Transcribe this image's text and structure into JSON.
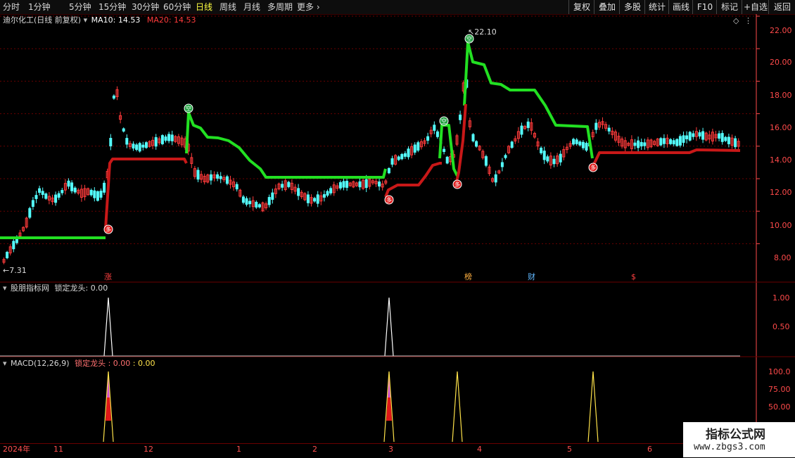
{
  "toolbar": {
    "periods": [
      "分时",
      "1分钟",
      "5分钟",
      "15分钟",
      "30分钟",
      "60分钟",
      "日线",
      "周线",
      "月线",
      "多周期",
      "更多"
    ],
    "active_period": "日线",
    "right_buttons": [
      "复权",
      "叠加",
      "多股",
      "统计",
      "画线",
      "F10",
      "标记",
      "+自选",
      "返回"
    ]
  },
  "main_panel": {
    "stock_name": "迪尔化工(日线 前复权)",
    "ma10_label": "MA10: 14.53",
    "ma20_label": "MA20: 14.53",
    "high_marker": "22.10",
    "low_marker": "7.31",
    "y_ticks": [
      "22.00",
      "20.00",
      "18.00",
      "16.00",
      "14.00",
      "12.00",
      "10.00",
      "8.00"
    ],
    "event_tags": [
      {
        "text": "涨",
        "color": "#ff4040"
      },
      {
        "text": "榜",
        "color": "#ffb040"
      },
      {
        "text": "财",
        "color": "#60b8ff"
      },
      {
        "text": "$",
        "color": "#ff4040"
      }
    ],
    "buy_label": "多",
    "sell_label": "空"
  },
  "panel2": {
    "title": "股朋指标网",
    "indicator": "锁定龙头: 0.00",
    "y_ticks": [
      "1.00",
      "0.50"
    ]
  },
  "panel3": {
    "title": "MACD(12,26,9)",
    "indicator": "锁定龙头 : 0.00",
    "value2": ": 0.00",
    "y_ticks": [
      "100.0",
      "75.00",
      "50.00"
    ]
  },
  "time_axis": {
    "labels": [
      "2024年",
      "11",
      "12",
      "1",
      "2",
      "3",
      "4",
      "5",
      "6"
    ]
  },
  "watermark": {
    "title": "指标公式网",
    "url": "www.zbgs3.com"
  },
  "colors": {
    "up": "#ff3b3b",
    "down": "#54ffff",
    "green_line": "#22e022",
    "red_line": "#c81818",
    "axis": "#ff4a4a",
    "grid": "#6a0000"
  }
}
